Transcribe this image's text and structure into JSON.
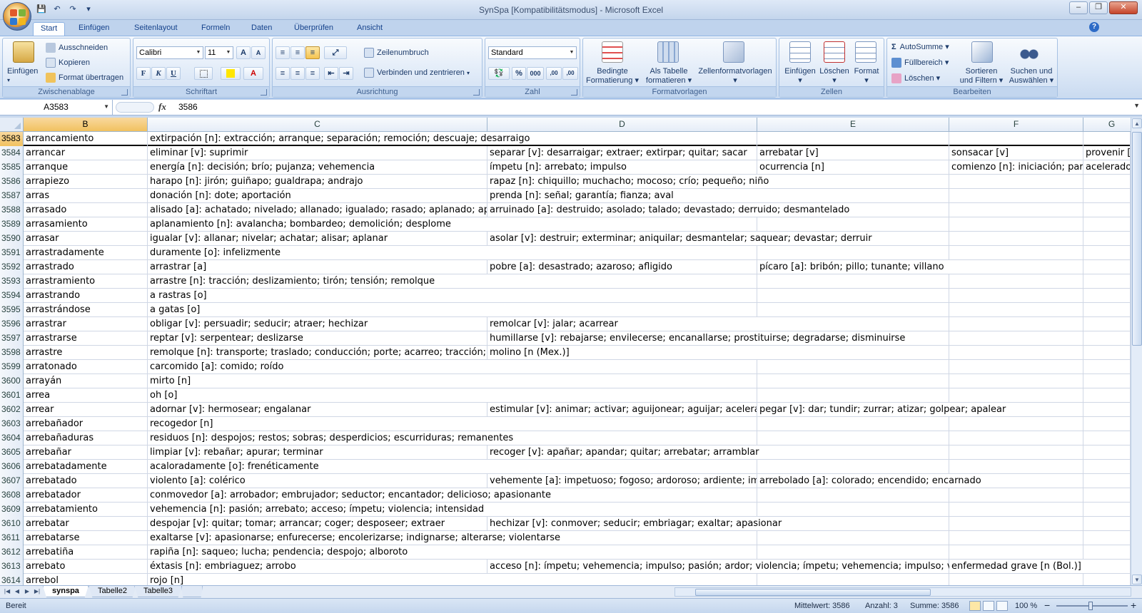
{
  "title_bar": {
    "title": "SynSpa  [Kompatibilitätsmodus]  -  Microsoft Excel",
    "minimize": "–",
    "restore": "❐",
    "close": "✕"
  },
  "qat": {
    "save": "💾",
    "undo": "↶",
    "redo": "↷",
    "customize": "▾"
  },
  "ribbon_tabs": [
    "Start",
    "Einfügen",
    "Seitenlayout",
    "Formeln",
    "Daten",
    "Überprüfen",
    "Ansicht"
  ],
  "help": "?",
  "clipboard": {
    "paste": "Einfügen",
    "cut": "Ausschneiden",
    "copy": "Kopieren",
    "format_painter": "Format übertragen",
    "label": "Zwischenablage"
  },
  "font": {
    "name": "Calibri",
    "size": "11",
    "bold": "F",
    "italic": "K",
    "underline": "U",
    "grow": "A",
    "shrink": "A",
    "color_a": "A",
    "label": "Schriftart"
  },
  "alignment": {
    "wrap": "Zeilenumbruch",
    "merge": "Verbinden und zentrieren",
    "label": "Ausrichtung"
  },
  "number": {
    "format": "Standard",
    "percent": "%",
    "thousands": "000",
    "dec_inc": ",00",
    "dec_dec": ",00",
    "label": "Zahl"
  },
  "styles": {
    "conditional_1": "Bedingte",
    "conditional_2": "Formatierung",
    "as_table_1": "Als Tabelle",
    "as_table_2": "formatieren",
    "cell_styles": "Zellenformatvorlagen",
    "label": "Formatvorlagen"
  },
  "cells": {
    "insert": "Einfügen",
    "delete": "Löschen",
    "format": "Format",
    "label": "Zellen"
  },
  "editing": {
    "autosum": "AutoSumme",
    "fill": "Füllbereich",
    "clear": "Löschen",
    "sort_1": "Sortieren",
    "sort_2": "und Filtern",
    "find_1": "Suchen und",
    "find_2": "Auswählen",
    "label": "Bearbeiten",
    "sigma": "Σ"
  },
  "formula_bar": {
    "name_box": "A3583",
    "fx": "fx",
    "content": "3586"
  },
  "columns": [
    "B",
    "C",
    "D",
    "E",
    "F",
    "G"
  ],
  "rows": [
    {
      "num": "3583",
      "b": "arrancamiento",
      "c": "extirpación [n]: extracción; arranque; separación; remoción; descuaje; desarraigo",
      "d": "",
      "e": "",
      "f": "",
      "g": ""
    },
    {
      "num": "3584",
      "b": "arrancar",
      "c": "eliminar [v]: suprimir",
      "d": "separar [v]: desarraigar; extraer; extirpar; quitar; sacar",
      "e": "arrebatar [v]",
      "f": "sonsacar [v]",
      "g": "provenir ["
    },
    {
      "num": "3585",
      "b": "arranque",
      "c": "energía [n]: decisión; brío; pujanza; vehemencia",
      "d": "ímpetu [n]: arrebato; impulso",
      "e": "ocurrencia [n]",
      "f": "comienzo [n]: iniciación; parti",
      "g": "acelerado"
    },
    {
      "num": "3586",
      "b": "arrapiezo",
      "c": "harapo [n]: jirón; guiñapo; gualdrapa; andrajo",
      "d": "rapaz [n]: chiquillo; muchacho; mocoso; crío; pequeño; niño",
      "e": "",
      "f": "",
      "g": ""
    },
    {
      "num": "3587",
      "b": "arras",
      "c": "donación [n]: dote; aportación",
      "d": "prenda [n]: señal; garantía; fianza; aval",
      "e": "",
      "f": "",
      "g": ""
    },
    {
      "num": "3588",
      "b": "arrasado",
      "c": "alisado [a]: achatado; nivelado; allanado; igualado; rasado; aplanado; aplasta",
      "d": "arruinado [a]: destruido; asolado; talado; devastado; derruido; desmantelado",
      "e": "",
      "f": "",
      "g": ""
    },
    {
      "num": "3589",
      "b": "arrasamiento",
      "c": "aplanamiento [n]: avalancha; bombardeo; demolición; desplome",
      "d": "",
      "e": "",
      "f": "",
      "g": ""
    },
    {
      "num": "3590",
      "b": "arrasar",
      "c": "igualar [v]: allanar; nivelar; achatar; alisar; aplanar",
      "d": "asolar [v]: destruir; exterminar; aniquilar; desmantelar; saquear; devastar; derruir",
      "e": "",
      "f": "",
      "g": ""
    },
    {
      "num": "3591",
      "b": "arrastradamente",
      "c": "duramente [o]: infelizmente",
      "d": "",
      "e": "",
      "f": "",
      "g": ""
    },
    {
      "num": "3592",
      "b": "arrastrado",
      "c": "arrastrar [a]",
      "d": "pobre [a]: desastrado; azaroso; afligido",
      "e": "pícaro [a]: bribón; pillo; tunante; villano",
      "f": "",
      "g": ""
    },
    {
      "num": "3593",
      "b": "arrastramiento",
      "c": "arrastre [n]: tracción; deslizamiento; tirón; tensión; remolque",
      "d": "",
      "e": "",
      "f": "",
      "g": ""
    },
    {
      "num": "3594",
      "b": "arrastrando",
      "c": "a rastras [o]",
      "d": "",
      "e": "",
      "f": "",
      "g": ""
    },
    {
      "num": "3595",
      "b": "arrastrándose",
      "c": "a gatas [o]",
      "d": "",
      "e": "",
      "f": "",
      "g": ""
    },
    {
      "num": "3596",
      "b": "arrastrar",
      "c": "obligar [v]: persuadir; seducir; atraer; hechizar",
      "d": "remolcar [v]: jalar; acarrear",
      "e": "",
      "f": "",
      "g": ""
    },
    {
      "num": "3597",
      "b": "arrastrarse",
      "c": "reptar [v]: serpentear; deslizarse",
      "d": "humillarse [v]: rebajarse; envilecerse; encanallarse; prostituirse; degradarse; disminuirse",
      "e": "",
      "f": "",
      "g": ""
    },
    {
      "num": "3598",
      "b": "arrastre",
      "c": "remolque [n]: transporte; traslado; conducción; porte; acarreo; tracción; emp",
      "d": "molino [n (Mex.)]",
      "e": "",
      "f": "",
      "g": ""
    },
    {
      "num": "3599",
      "b": "arratonado",
      "c": "carcomido [a]: comido; roído",
      "d": "",
      "e": "",
      "f": "",
      "g": ""
    },
    {
      "num": "3600",
      "b": "arrayán",
      "c": "mirto [n]",
      "d": "",
      "e": "",
      "f": "",
      "g": ""
    },
    {
      "num": "3601",
      "b": "arrea",
      "c": "oh [o]",
      "d": "",
      "e": "",
      "f": "",
      "g": ""
    },
    {
      "num": "3602",
      "b": "arrear",
      "c": "adornar [v]: hermosear; engalanar",
      "d": "estimular [v]: animar; activar; aguijonear; aguijar; acelerar; ex",
      "e": "pegar [v]: dar; tundir; zurrar; atizar; golpear; apalear",
      "f": "",
      "g": ""
    },
    {
      "num": "3603",
      "b": "arrebañador",
      "c": "recogedor [n]",
      "d": "",
      "e": "",
      "f": "",
      "g": ""
    },
    {
      "num": "3604",
      "b": "arrebañaduras",
      "c": "residuos [n]: despojos; restos; sobras; desperdicios; escurriduras; remanentes",
      "d": "",
      "e": "",
      "f": "",
      "g": ""
    },
    {
      "num": "3605",
      "b": "arrebañar",
      "c": "limpiar [v]: rebañar; apurar; terminar",
      "d": "recoger [v]: apañar; apandar; quitar; arrebatar; arramblar",
      "e": "",
      "f": "",
      "g": ""
    },
    {
      "num": "3606",
      "b": "arrebatadamente",
      "c": "acaloradamente [o]: frenéticamente",
      "d": "",
      "e": "",
      "f": "",
      "g": ""
    },
    {
      "num": "3607",
      "b": "arrebatado",
      "c": "violento [a]: colérico",
      "d": "vehemente [a]: impetuoso; fogoso; ardoroso; ardiente; impu",
      "e": "arrebolado [a]: colorado; encendido; encarnado",
      "f": "",
      "g": ""
    },
    {
      "num": "3608",
      "b": "arrebatador",
      "c": "conmovedor [a]: arrobador; embrujador; seductor; encantador; delicioso; apasionante",
      "d": "",
      "e": "",
      "f": "",
      "g": ""
    },
    {
      "num": "3609",
      "b": "arrebatamiento",
      "c": "vehemencia [n]: pasión; arrebato; acceso; ímpetu; violencia; intensidad",
      "d": "",
      "e": "",
      "f": "",
      "g": ""
    },
    {
      "num": "3610",
      "b": "arrebatar",
      "c": "despojar [v]: quitar; tomar; arrancar; coger; desposeer; extraer",
      "d": "hechizar [v]: conmover; seducir; embriagar; exaltar; apasionar",
      "e": "",
      "f": "",
      "g": ""
    },
    {
      "num": "3611",
      "b": "arrebatarse",
      "c": "exaltarse [v]: apasionarse; enfurecerse; encolerizarse; indignarse; alterarse; violentarse",
      "d": "",
      "e": "",
      "f": "",
      "g": ""
    },
    {
      "num": "3612",
      "b": "arrebatiña",
      "c": "rapiña [n]: saqueo; lucha; pendencia; despojo; alboroto",
      "d": "",
      "e": "",
      "f": "",
      "g": ""
    },
    {
      "num": "3613",
      "b": "arrebato",
      "c": "éxtasis [n]: embriaguez; arrobo",
      "d": "acceso [n]: ímpetu; vehemencia; impulso; pasión; ardor; violencia; ímpetu; vehemencia; impulso; violenc",
      "e": "",
      "f": "enfermedad grave [n (Bol.)]",
      "g": ""
    },
    {
      "num": "3614",
      "b": "arrebol",
      "c": "rojo [n]",
      "d": "",
      "e": "",
      "f": "",
      "g": ""
    }
  ],
  "sheet_tabs": [
    "synspa",
    "Tabelle2",
    "Tabelle3"
  ],
  "status": {
    "ready": "Bereit",
    "average": "Mittelwert: 3586",
    "count": "Anzahl: 3",
    "sum": "Summe: 3586",
    "zoom": "100 %",
    "zoom_out": "−",
    "zoom_in": "+"
  },
  "colors": {
    "selected_header": "#f1c15f",
    "grid_line": "#d0d7e5",
    "ribbon_text": "#15428b"
  }
}
